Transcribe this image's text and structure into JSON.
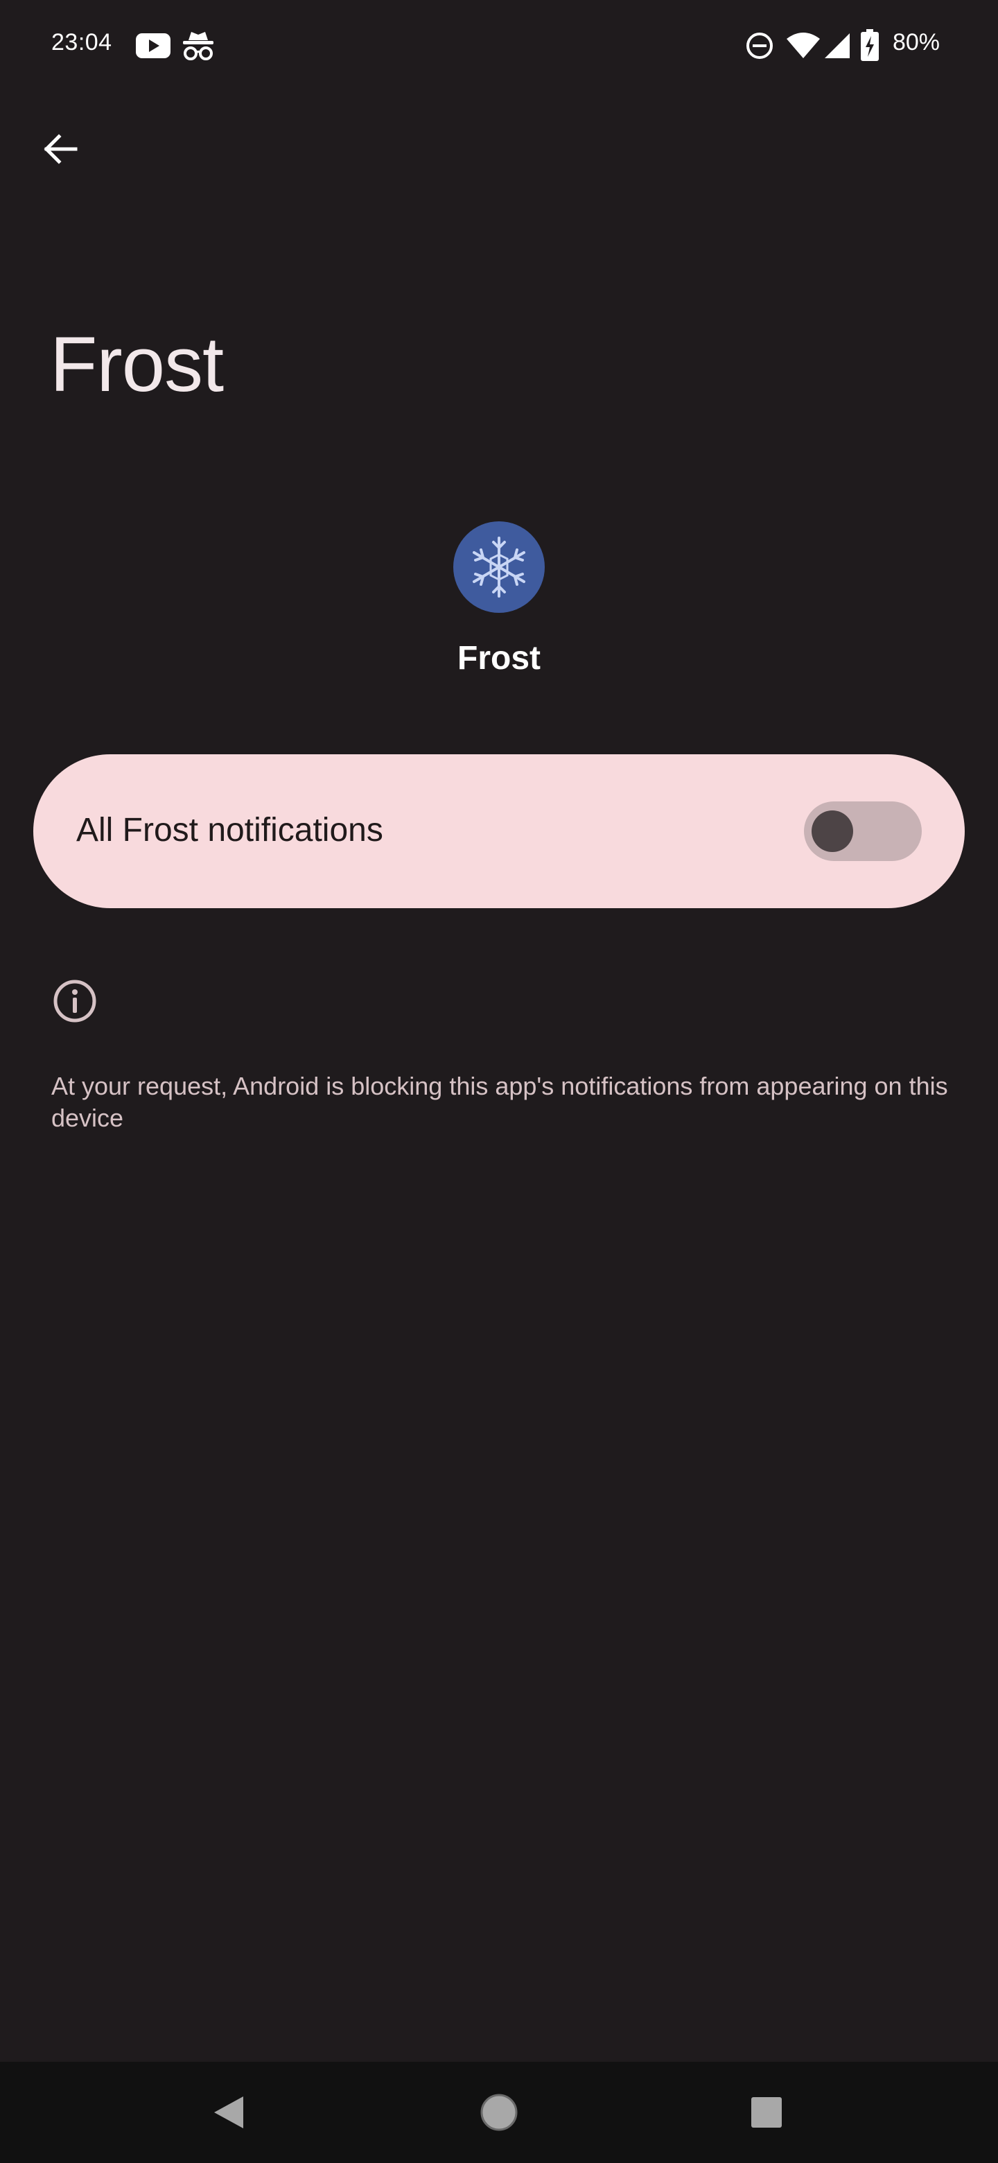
{
  "status_bar": {
    "time": "23:04",
    "battery_percent": "80%",
    "icons_left": [
      "youtube-icon",
      "incognito-icon"
    ],
    "icons_right": [
      "do-not-disturb-icon",
      "wifi-icon",
      "cell-signal-icon",
      "battery-charging-icon"
    ]
  },
  "header": {
    "back_icon": "arrow-back-icon",
    "title": "Frost"
  },
  "app": {
    "name": "Frost",
    "icon": "snowflake-icon",
    "icon_bg": "#3f5b9e"
  },
  "toggle_card": {
    "label": "All Frost notifications",
    "enabled": false,
    "bg_color": "#f8dadd"
  },
  "info": {
    "icon": "info-icon",
    "text": "At your request, Android is blocking this app's notifications from appearing on this device"
  },
  "nav_bar": {
    "buttons": [
      "back-triangle-icon",
      "home-circle-icon",
      "recents-square-icon"
    ]
  }
}
